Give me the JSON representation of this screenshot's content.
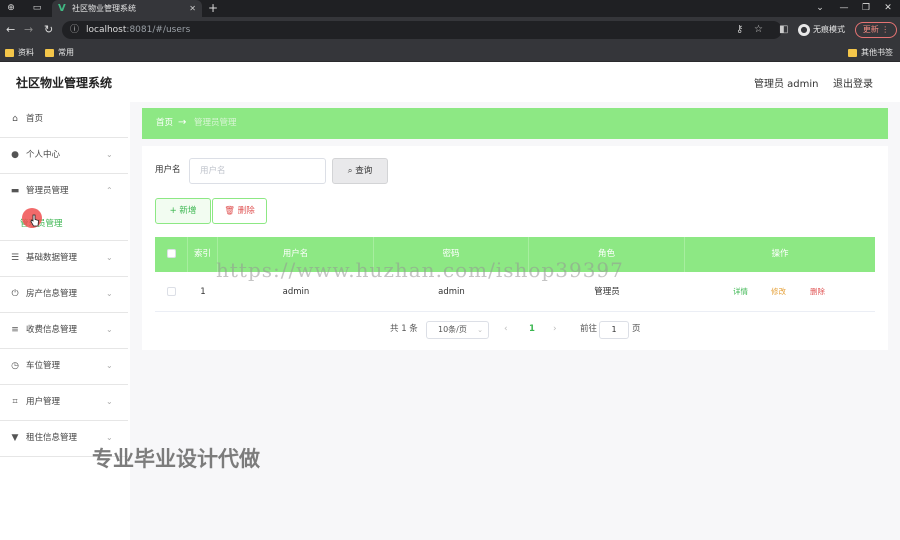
{
  "browser": {
    "tab_title": "社区物业管理系统",
    "url_host": "localhost",
    "url_path": ":8081/#/users",
    "incognito_label": "无痕模式",
    "update_label": "更新",
    "bookmarks": [
      "资料",
      "常用"
    ],
    "other_bookmarks": "其他书签"
  },
  "header": {
    "title": "社区物业管理系统",
    "user": "管理员 admin",
    "logout": "退出登录"
  },
  "sidebar": {
    "items": [
      {
        "label": "首页",
        "icon": "home-icon"
      },
      {
        "label": "个人中心",
        "icon": "user-icon"
      },
      {
        "label": "管理员管理",
        "icon": "monitor-icon"
      },
      {
        "label": "基础数据管理",
        "icon": "sliders-icon"
      },
      {
        "label": "房产信息管理",
        "icon": "power-icon"
      },
      {
        "label": "收费信息管理",
        "icon": "list-icon"
      },
      {
        "label": "车位管理",
        "icon": "gauge-icon"
      },
      {
        "label": "用户管理",
        "icon": "crop-icon"
      },
      {
        "label": "租住信息管理",
        "icon": "filter-icon"
      }
    ],
    "sub_item": "管理员管理"
  },
  "breadcrumb": {
    "home": "首页",
    "current": "管理员管理"
  },
  "search": {
    "label": "用户名",
    "placeholder": "用户名",
    "button": "查询"
  },
  "actions": {
    "add": "新增",
    "delete": "删除"
  },
  "table": {
    "columns": [
      "索引",
      "用户名",
      "密码",
      "角色",
      "操作"
    ],
    "rows": [
      {
        "index": "1",
        "username": "admin",
        "password": "admin",
        "role": "管理员"
      }
    ],
    "row_actions": [
      "详情",
      "修改",
      "删除"
    ]
  },
  "pagination": {
    "total": "共 1 条",
    "page_size": "10条/页",
    "current_page": "1",
    "goto_label": "前往",
    "goto_value": "1",
    "page_suffix": "页"
  },
  "watermarks": {
    "url": "https://www.huzhan.com/ishop39397",
    "text": "专业毕业设计代做"
  },
  "colors": {
    "accent": "#8de884",
    "accent_text": "#3bb650",
    "danger": "#e05555",
    "edit": "#e6a23c"
  }
}
